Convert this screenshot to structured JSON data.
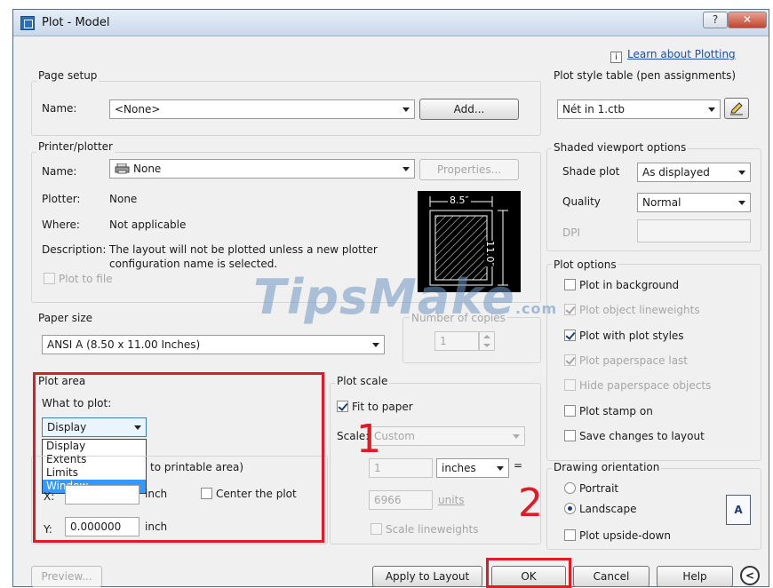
{
  "window": {
    "title": "Plot - Model",
    "help_label": "?",
    "close_label": "✕"
  },
  "header": {
    "learn_link": "Learn about Plotting",
    "info_glyph": "i"
  },
  "page_setup": {
    "group_label": "Page setup",
    "name_label": "Name:",
    "name_value": "<None>",
    "add_button": "Add..."
  },
  "printer": {
    "group_label": "Printer/plotter",
    "name_label": "Name:",
    "name_value": "None",
    "properties_button": "Properties...",
    "plotter_label": "Plotter:",
    "plotter_value": "None",
    "where_label": "Where:",
    "where_value": "Not applicable",
    "description_label": "Description:",
    "description_line1": "The layout will not be plotted unless a new plotter",
    "description_line2": "configuration name is selected.",
    "plot_to_file": "Plot to file",
    "preview_width": "8.5″",
    "preview_height": "11.0″"
  },
  "paper_size": {
    "group_label": "Paper size",
    "value": "ANSI A (8.50 x 11.00 Inches)"
  },
  "copies": {
    "label": "Number of copies",
    "value": "1"
  },
  "plot_area": {
    "group_label": "Plot area",
    "what_label": "What to plot:",
    "selected": "Display",
    "options": [
      "Display",
      "Extents",
      "Limits",
      "Window"
    ],
    "highlighted_option": "Window"
  },
  "plot_offset": {
    "label_tail": "to printable area)",
    "x_label": "X:",
    "x_unit": "inch",
    "center_label": "Center the plot",
    "y_label": "Y:",
    "y_value": "0.000000",
    "y_unit": "inch"
  },
  "plot_scale": {
    "group_label": "Plot scale",
    "fit_label": "Fit to paper",
    "scale_label": "Scale:",
    "scale_value": "Custom",
    "value1": "1",
    "units_value": "inches",
    "equals": "=",
    "value2": "6966",
    "units_label": "units",
    "scale_lineweights": "Scale lineweights"
  },
  "style_table": {
    "group_label": "Plot style table (pen assignments)",
    "value": "Nét in  1.ctb"
  },
  "shaded": {
    "group_label": "Shaded viewport options",
    "shade_label": "Shade plot",
    "shade_value": "As displayed",
    "quality_label": "Quality",
    "quality_value": "Normal",
    "dpi_label": "DPI"
  },
  "plot_options": {
    "group_label": "Plot options",
    "items": [
      {
        "label": "Plot in background",
        "checked": false,
        "disabled": false
      },
      {
        "label": "Plot object lineweights",
        "checked": true,
        "disabled": true
      },
      {
        "label": "Plot with plot styles",
        "checked": true,
        "disabled": false
      },
      {
        "label": "Plot paperspace last",
        "checked": true,
        "disabled": true
      },
      {
        "label": "Hide paperspace objects",
        "checked": false,
        "disabled": true
      },
      {
        "label": "Plot stamp on",
        "checked": false,
        "disabled": false
      },
      {
        "label": "Save changes to layout",
        "checked": false,
        "disabled": false
      }
    ]
  },
  "orientation": {
    "group_label": "Drawing orientation",
    "portrait": "Portrait",
    "landscape": "Landscape",
    "upside_down": "Plot upside-down",
    "landscape_glyph": "A"
  },
  "footer": {
    "preview": "Preview...",
    "apply": "Apply to Layout",
    "ok": "OK",
    "cancel": "Cancel",
    "help": "Help",
    "expand_glyph": "<"
  },
  "annotations": {
    "callout1": "1",
    "callout2": "2",
    "highlight_color": "#e01b24"
  },
  "watermark": {
    "brand": "TipsMake",
    "suffix": ".com"
  }
}
